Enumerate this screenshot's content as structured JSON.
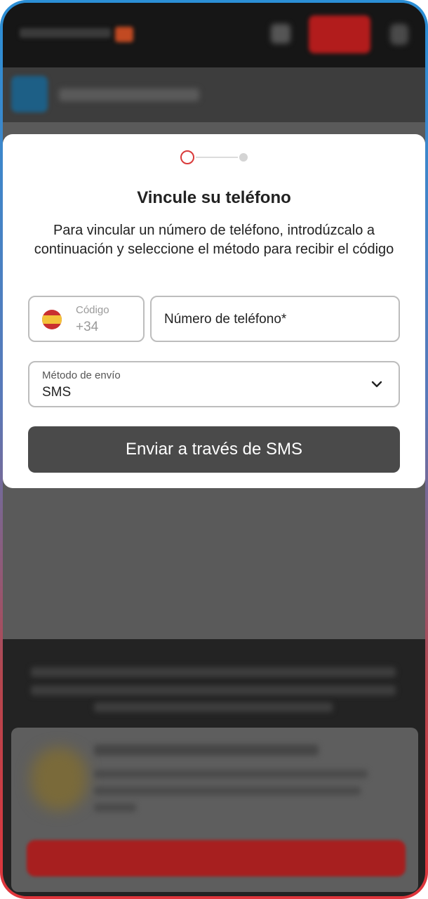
{
  "modal": {
    "title": "Vincule su teléfono",
    "description": "Para vincular un número de teléfono, introdúzcalo a continuación y seleccione el método para recibir el código",
    "country_code": {
      "label": "Código",
      "value": "+34",
      "flag_icon": "spain-flag-icon"
    },
    "phone": {
      "placeholder": "Número de teléfono*",
      "value": ""
    },
    "method": {
      "label": "Método de envío",
      "selected": "SMS",
      "chevron_icon": "chevron-down-icon"
    },
    "submit_label": "Enviar a través de SMS",
    "stepper": {
      "current_step": 1,
      "total_steps": 2
    }
  },
  "colors": {
    "accent": "#d93a3a",
    "button": "#4a4a4a",
    "overlay": "#5a5a5a",
    "frame_top": "#2b8fd6",
    "frame_bottom": "#e0353b"
  }
}
